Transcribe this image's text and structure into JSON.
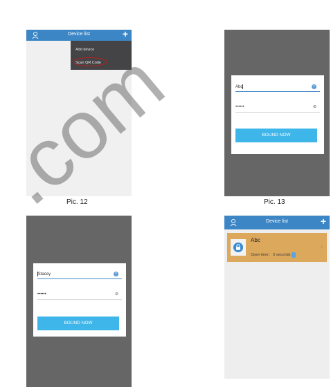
{
  "pic12": {
    "topbar_title": "Device list",
    "menu": {
      "add": "Add device",
      "scan": "Scan QR Code"
    },
    "caption": "Pic. 12",
    "colors": {
      "topbar": "#3d86c6",
      "menu": "#444446",
      "highlight": "#c21b1b"
    }
  },
  "pic13": {
    "username": "Abc",
    "password_mask": "••••••",
    "button": "BOUND NOW",
    "caption": "Pic. 13"
  },
  "pic14": {
    "username": "Stacey",
    "password_mask": "••••••",
    "button": "BOUND NOW"
  },
  "pic15": {
    "topbar_title": "Device list",
    "device_name": "Abc",
    "open_time": "Open time： 5 seconds",
    "colors": {
      "card": "#dca85c",
      "button": "#3eb6ea"
    }
  },
  "watermark": ".com"
}
